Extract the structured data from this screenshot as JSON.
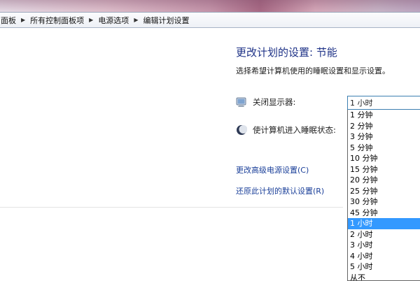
{
  "breadcrumb": {
    "items": [
      "面板",
      "所有控制面板项",
      "电源选项",
      "编辑计划设置"
    ]
  },
  "main": {
    "title": "更改计划的设置: 节能",
    "subtitle": "选择希望计算机使用的睡眠设置和显示设置。",
    "settings": {
      "display_label": "关闭显示器:",
      "sleep_label": "使计算机进入睡眠状态:"
    },
    "links": {
      "advanced": "更改高级电源设置(C)",
      "restore": "还原此计划的默认设置(R)"
    }
  },
  "display_select": {
    "value": "1 小时",
    "options": [
      "1 分钟",
      "2 分钟",
      "3 分钟",
      "5 分钟",
      "10 分钟",
      "15 分钟",
      "20 分钟",
      "25 分钟",
      "30 分钟",
      "45 分钟",
      "1 小时",
      "2 小时",
      "3 小时",
      "4 小时",
      "5 小时",
      "从不"
    ],
    "selected_index": 10
  },
  "icons": {
    "display": "monitor-icon",
    "sleep": "moon-icon"
  },
  "colors": {
    "title": "#1e3287",
    "link": "#1a3f99",
    "selection": "#3399ff",
    "combo_border": "#3c7fb1"
  }
}
